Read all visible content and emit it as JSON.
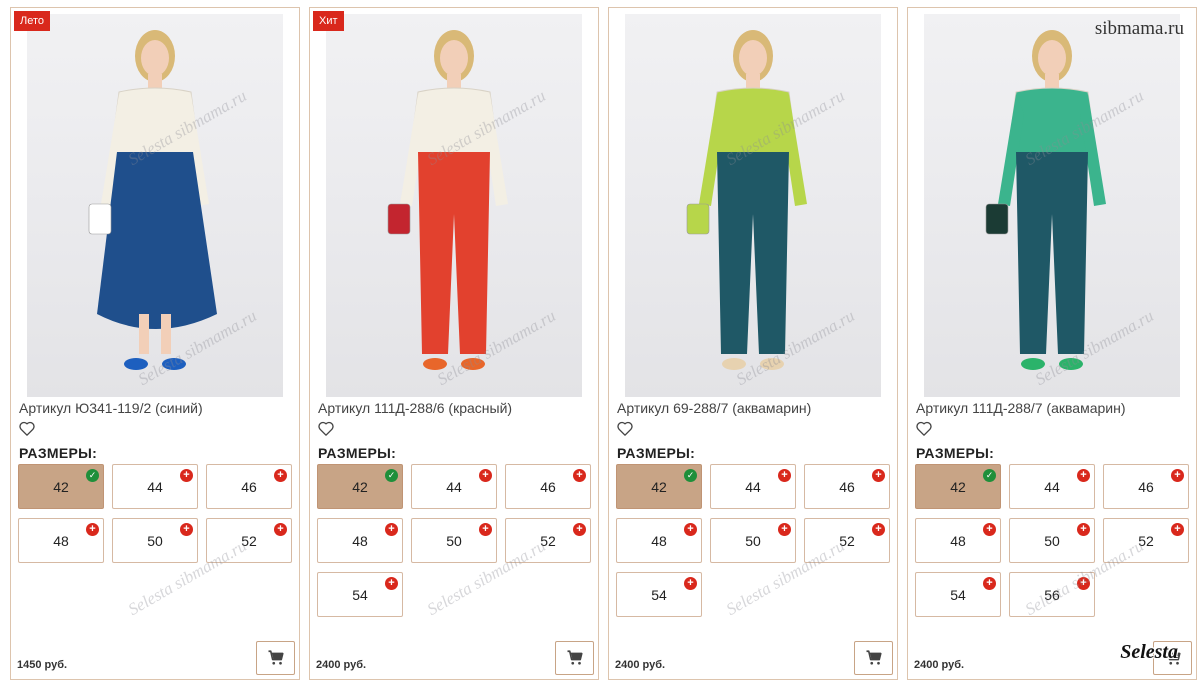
{
  "watermarks": {
    "site": "sibmama.ru",
    "brand": "Selesta",
    "diagonal": "Selesta sibmama.ru"
  },
  "colors": {
    "accent": "#c8a486",
    "badge": "#d9281c",
    "border": "#ddc4ad",
    "ok": "#1f8f3a"
  },
  "sizes_heading": "РАЗМЕРЫ:",
  "cards": [
    {
      "badge": "Лето",
      "title": "Артикул Ю341-119/2 (синий)",
      "price": "1450 руб.",
      "sizes": [
        {
          "label": "42",
          "selected": true
        },
        {
          "label": "44"
        },
        {
          "label": "46"
        },
        {
          "label": "48"
        },
        {
          "label": "50"
        },
        {
          "label": "52"
        }
      ],
      "outfit": {
        "top": "#f3efe4",
        "bottom": "#1f4f8c",
        "bottom_type": "skirt",
        "shoes": "#1d5fbf",
        "bag": "#ffffff"
      }
    },
    {
      "badge": "Хит",
      "title": "Артикул 111Д-288/6 (красный)",
      "price": "2400 руб.",
      "sizes": [
        {
          "label": "42",
          "selected": true
        },
        {
          "label": "44"
        },
        {
          "label": "46"
        },
        {
          "label": "48"
        },
        {
          "label": "50"
        },
        {
          "label": "52"
        },
        {
          "label": "54"
        }
      ],
      "outfit": {
        "top": "#f3efe4",
        "bottom": "#e2412e",
        "bottom_type": "pants",
        "shoes": "#e8662a",
        "bag": "#c3252f"
      }
    },
    {
      "badge": "",
      "title": "Артикул 69-288/7 (аквамарин)",
      "price": "2400 руб.",
      "sizes": [
        {
          "label": "42",
          "selected": true
        },
        {
          "label": "44"
        },
        {
          "label": "46"
        },
        {
          "label": "48"
        },
        {
          "label": "50"
        },
        {
          "label": "52"
        },
        {
          "label": "54"
        }
      ],
      "outfit": {
        "top": "#b7d64a",
        "bottom": "#1f5866",
        "bottom_type": "pants",
        "shoes": "#e7d2b0",
        "bag": "#b7d64a"
      }
    },
    {
      "badge": "",
      "title": "Артикул 111Д-288/7 (аквамарин)",
      "price": "2400 руб.",
      "sizes": [
        {
          "label": "42",
          "selected": true
        },
        {
          "label": "44"
        },
        {
          "label": "46"
        },
        {
          "label": "48"
        },
        {
          "label": "50"
        },
        {
          "label": "52"
        },
        {
          "label": "54"
        },
        {
          "label": "56"
        }
      ],
      "outfit": {
        "top": "#3bb48d",
        "bottom": "#1f5866",
        "bottom_type": "pants",
        "shoes": "#2bb36a",
        "bag": "#1b3b34"
      }
    }
  ]
}
